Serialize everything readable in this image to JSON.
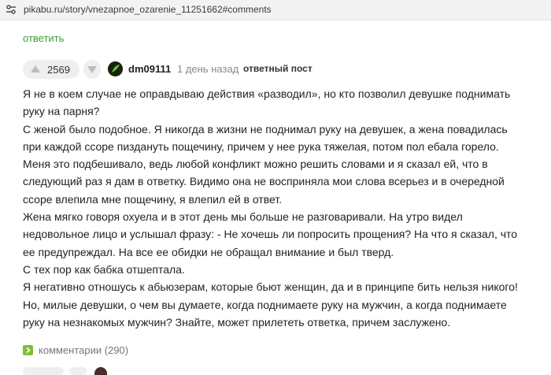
{
  "browser": {
    "url": "pikabu.ru/story/vnezapnoe_ozarenie_11251662#comments",
    "site_icon": "tune-icon"
  },
  "top_reply": {
    "label": "ответить"
  },
  "comment": {
    "rating": "2569",
    "author": "dm09111",
    "time": "1 день назад",
    "tag": "ответный пост",
    "lines": [
      "Я не в коем случае не оправдываю действия «разводил», но кто позволил девушке поднимать руку на парня?",
      "С женой было подобное. Я никогда в жизни не поднимал руку на девушек, а жена повадилась при каждой ссоре пиздануть пощечину, причем у нее рука тяжелая, потом пол ебала горело.",
      "Меня это подбешивало, ведь любой конфликт можно решить словами и я сказал ей, что в следующий раз я дам в ответку. Видимо она не восприняла мои слова всерьез и в очередной ссоре влепила мне пощечину, я влепил ей в ответ.",
      "Жена мягко говоря охуела и в этот день мы больше не разговаривали. На утро видел недовольное лицо и услышал фразу: - Не хочешь ли попросить прощения? На что я сказал, что ее предупреждал. На все ее обидки не обращал внимание и был тверд.",
      "С тех пор как бабка отшептала.",
      "Я негативно отношусь к абьюзерам, которые бьют женщин, да и в принципе бить нельзя никого! Но, милые девушки, о чем вы думаете, когда поднимаете руку на мужчин, а когда поднимаете руку на незнакомых мужчин? Знайте, может прилететь ответка, причем заслужено."
    ],
    "comments_toggle": "комментарии (290)"
  },
  "colors": {
    "accent_green": "#3a9d36",
    "toggle_green": "#7fbf3a",
    "pill_bg": "#efefef"
  }
}
